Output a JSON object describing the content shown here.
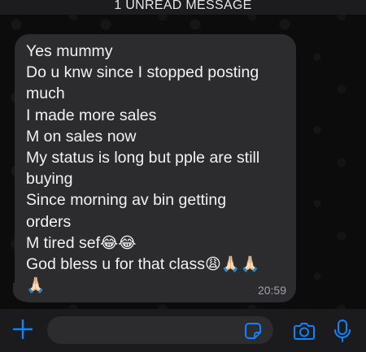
{
  "banner": {
    "text": "1 UNREAD MESSAGE"
  },
  "message": {
    "lines": [
      "Yes mummy",
      "Do u knw since I stopped posting",
      "much",
      "I made more sales",
      "M on sales now",
      "My status is long but pple are still",
      "buying",
      "Since morning av bin getting",
      "orders",
      "M tired sef",
      "God bless u for that class"
    ],
    "emoji_after_tired": "😂😂",
    "emoji_after_class": "😩🙏🏻🙏🏻",
    "emoji_last_line": "🙏🏻",
    "time": "20:59"
  },
  "composer": {
    "placeholder": "",
    "value": ""
  },
  "icons": {
    "add": "plus-icon",
    "sticker": "sticker-icon",
    "camera": "camera-icon",
    "microphone": "microphone-icon"
  },
  "colors": {
    "accent": "#0a84ff",
    "bubble": "#2c2c2e",
    "background": "#0b0b0c",
    "text": "#f2f2f4",
    "timestamp": "#a1a1a6"
  }
}
